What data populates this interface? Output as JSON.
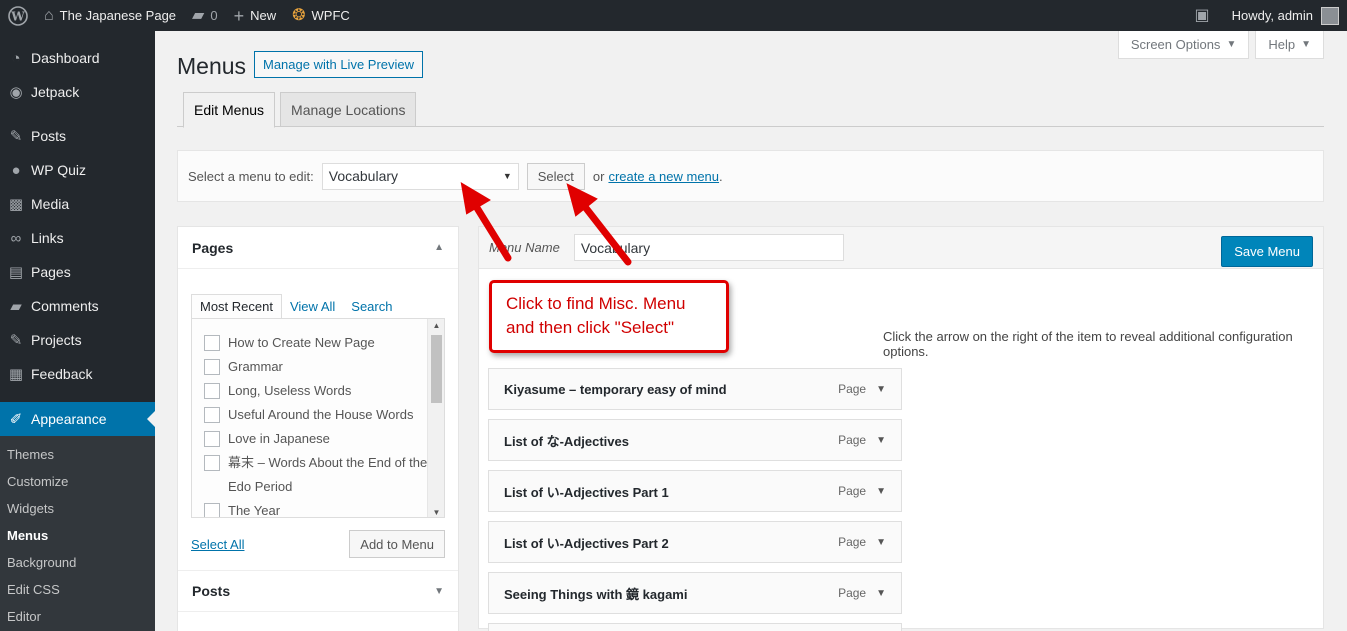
{
  "adminbar": {
    "site_name": "The Japanese Page",
    "comments_count": "0",
    "new_label": "New",
    "wpfc_label": "WPFC",
    "howdy": "Howdy, admin"
  },
  "sidebar": {
    "items": [
      {
        "label": "Dashboard",
        "icon": "dashboard-icon"
      },
      {
        "label": "Jetpack",
        "icon": "jetpack-icon"
      },
      {
        "label": "Posts",
        "icon": "pin-icon"
      },
      {
        "label": "WP Quiz",
        "icon": "quiz-icon"
      },
      {
        "label": "Media",
        "icon": "media-icon"
      },
      {
        "label": "Links",
        "icon": "link-icon"
      },
      {
        "label": "Pages",
        "icon": "pages-icon"
      },
      {
        "label": "Comments",
        "icon": "comment-icon"
      },
      {
        "label": "Projects",
        "icon": "pin-icon"
      },
      {
        "label": "Feedback",
        "icon": "feedback-icon"
      },
      {
        "label": "Appearance",
        "icon": "brush-icon"
      }
    ],
    "submenu": [
      "Themes",
      "Customize",
      "Widgets",
      "Menus",
      "Background",
      "Edit CSS",
      "Editor"
    ]
  },
  "header": {
    "screen_options": "Screen Options",
    "help": "Help",
    "title": "Menus",
    "live_preview": "Manage with Live Preview",
    "tabs": [
      "Edit Menus",
      "Manage Locations"
    ]
  },
  "select_bar": {
    "label": "Select a menu to edit:",
    "selected": "Vocabulary",
    "button": "Select",
    "or_text": "or",
    "create_link": "create a new menu",
    "period": "."
  },
  "pages_box": {
    "title": "Pages",
    "tabs": [
      "Most Recent",
      "View All",
      "Search"
    ],
    "items": [
      "How to Create New Page",
      "Grammar",
      "Long, Useless Words",
      "Useful Around the House Words",
      "Love in Japanese",
      "幕末 – Words About the End of the Edo Period",
      "The Year"
    ],
    "select_all": "Select All",
    "add_button": "Add to Menu"
  },
  "posts_box": {
    "title": "Posts"
  },
  "editor": {
    "menu_name_label": "Menu Name",
    "menu_name_value": "Vocabulary",
    "save_button": "Save Menu",
    "instructions": "Click the arrow on the right of the item to reveal additional configuration options.",
    "item_type": "Page",
    "items": [
      "Kiyasume – temporary easy of mind",
      "List of な-Adjectives",
      "List of い-Adjectives Part 1",
      "List of い-Adjectives Part 2",
      "Seeing Things with 鏡 kagami"
    ]
  },
  "callout": {
    "line1": "Click to find Misc. Menu",
    "line2": "and then click \"Select\""
  },
  "colors": {
    "primary": "#0085ba",
    "accent": "#0073aa",
    "annotation": "#e00000",
    "sidebar": "#23282d"
  }
}
